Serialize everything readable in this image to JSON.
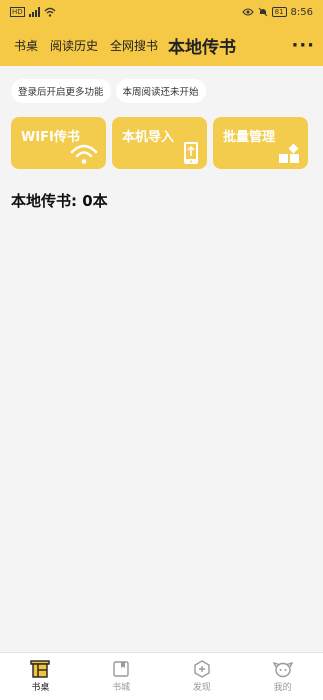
{
  "status_bar": {
    "time": "8:56",
    "battery": "81"
  },
  "header": {
    "tabs": [
      {
        "label": "书桌"
      },
      {
        "label": "阅读历史"
      },
      {
        "label": "全网搜书"
      },
      {
        "label": "本地传书",
        "active": true
      }
    ],
    "more_label": "···"
  },
  "chips": [
    "登录后开启更多功能",
    "本周阅读还未开始"
  ],
  "cards": [
    {
      "label": "WIFI传书",
      "icon": "wifi-icon"
    },
    {
      "label": "本机导入",
      "icon": "phone-upload-icon"
    },
    {
      "label": "批量管理",
      "icon": "grid-icon"
    }
  ],
  "count_text": "本地传书: 0本",
  "bottom_nav": [
    {
      "label": "书桌",
      "icon": "bookshelf-icon",
      "active": true
    },
    {
      "label": "书城",
      "icon": "book-icon"
    },
    {
      "label": "发现",
      "icon": "discover-icon"
    },
    {
      "label": "我的",
      "icon": "profile-icon"
    }
  ],
  "colors": {
    "accent": "#f5c945",
    "card": "#f3cc4e",
    "background": "#f4f4f4"
  }
}
